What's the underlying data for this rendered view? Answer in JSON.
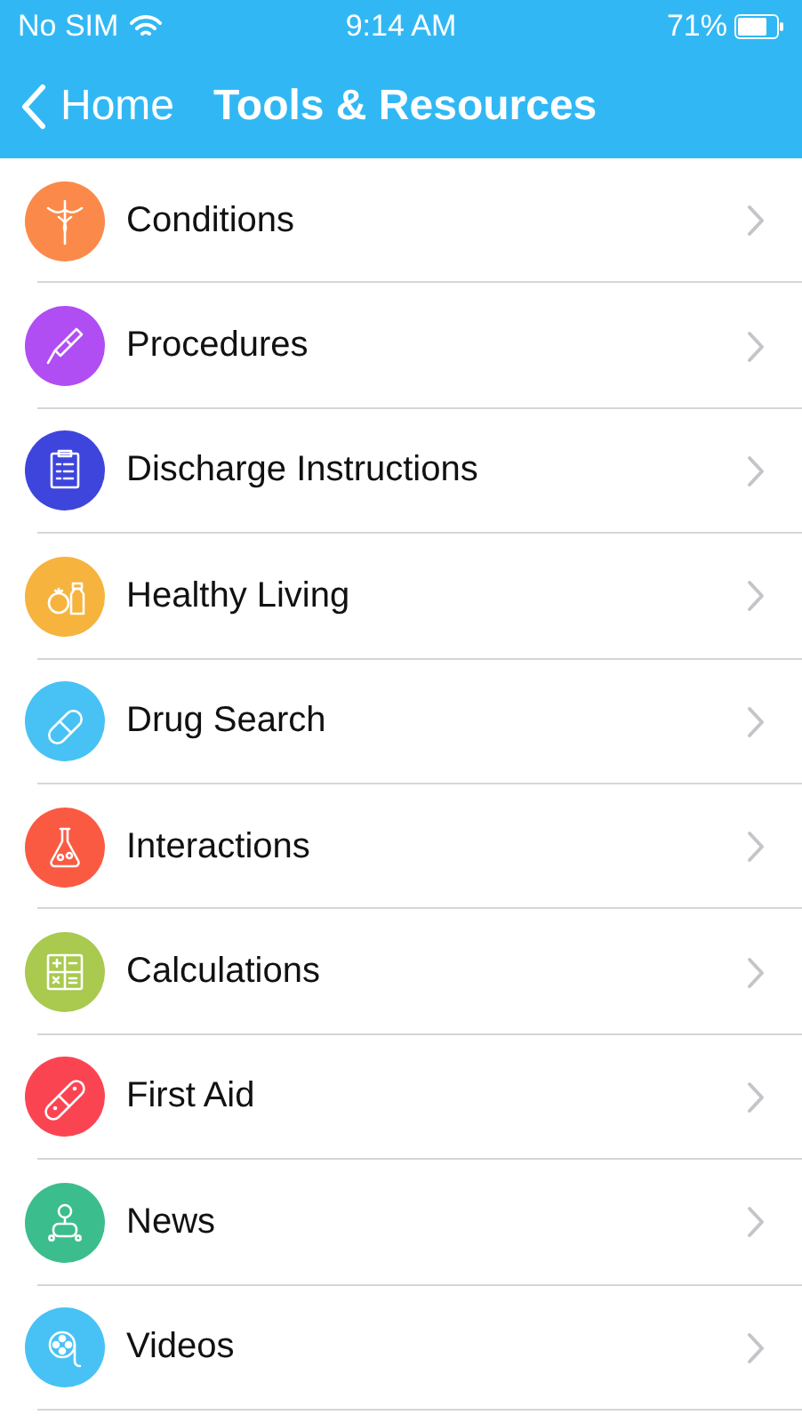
{
  "status_bar": {
    "carrier": "No SIM",
    "time": "9:14 AM",
    "battery": "71%"
  },
  "nav": {
    "back": "Home",
    "title": "Tools & Resources"
  },
  "items": [
    {
      "label": "Conditions",
      "kind": "caduceus",
      "color": "#fb8a4a"
    },
    {
      "label": "Procedures",
      "kind": "syringe",
      "color": "#b04df3"
    },
    {
      "label": "Discharge Instructions",
      "kind": "clipboard",
      "color": "#3e45dc"
    },
    {
      "label": "Healthy Living",
      "kind": "food",
      "color": "#f6b33e"
    },
    {
      "label": "Drug Search",
      "kind": "pill",
      "color": "#48c2f4"
    },
    {
      "label": "Interactions",
      "kind": "flask",
      "color": "#fb5a42"
    },
    {
      "label": "Calculations",
      "kind": "calculator",
      "color": "#a9c94f"
    },
    {
      "label": "First Aid",
      "kind": "bandage",
      "color": "#fb4452"
    },
    {
      "label": "News",
      "kind": "person",
      "color": "#3cbd8e"
    },
    {
      "label": "Videos",
      "kind": "film",
      "color": "#48c2f4"
    }
  ]
}
